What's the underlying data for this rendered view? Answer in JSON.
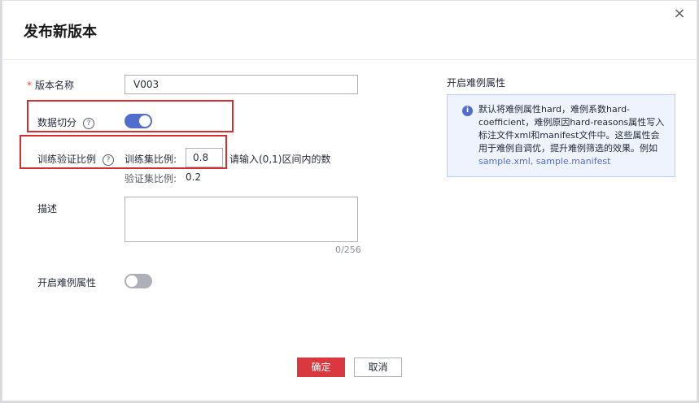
{
  "dialog": {
    "title": "发布新版本",
    "close_icon": "×"
  },
  "form": {
    "required_mark": "*",
    "version_name_label": "版本名称",
    "version_name_value": "V003",
    "data_split_label": "数据切分",
    "data_split_enabled": true,
    "train_val_label": "训练验证比例",
    "help_icon": "?",
    "train_ratio_label": "训练集比例:",
    "train_ratio_value": "0.8",
    "train_ratio_hint": "请输入(0,1)区间内的数",
    "val_ratio_label": "验证集比例:",
    "val_ratio_value": "0.2",
    "description_label": "描述",
    "description_value": "",
    "description_counter": "0/256",
    "hard_example_label": "开启难例属性",
    "hard_example_enabled": false
  },
  "info": {
    "title": "开启难例属性",
    "icon": "i",
    "text": "默认将难例属性hard，难例系数hard-coefficient，难例原因hard-reasons属性写入标注文件xml和manifest文件中。这些属性会用于难例自调优，提升难例筛选的效果。例如",
    "link": "sample.xml, sample.manifest"
  },
  "buttons": {
    "confirm": "确定",
    "cancel": "取消"
  },
  "colors": {
    "accent": "#526ecc",
    "primary_button": "#d9383f",
    "highlight_box": "#d32f2f"
  }
}
